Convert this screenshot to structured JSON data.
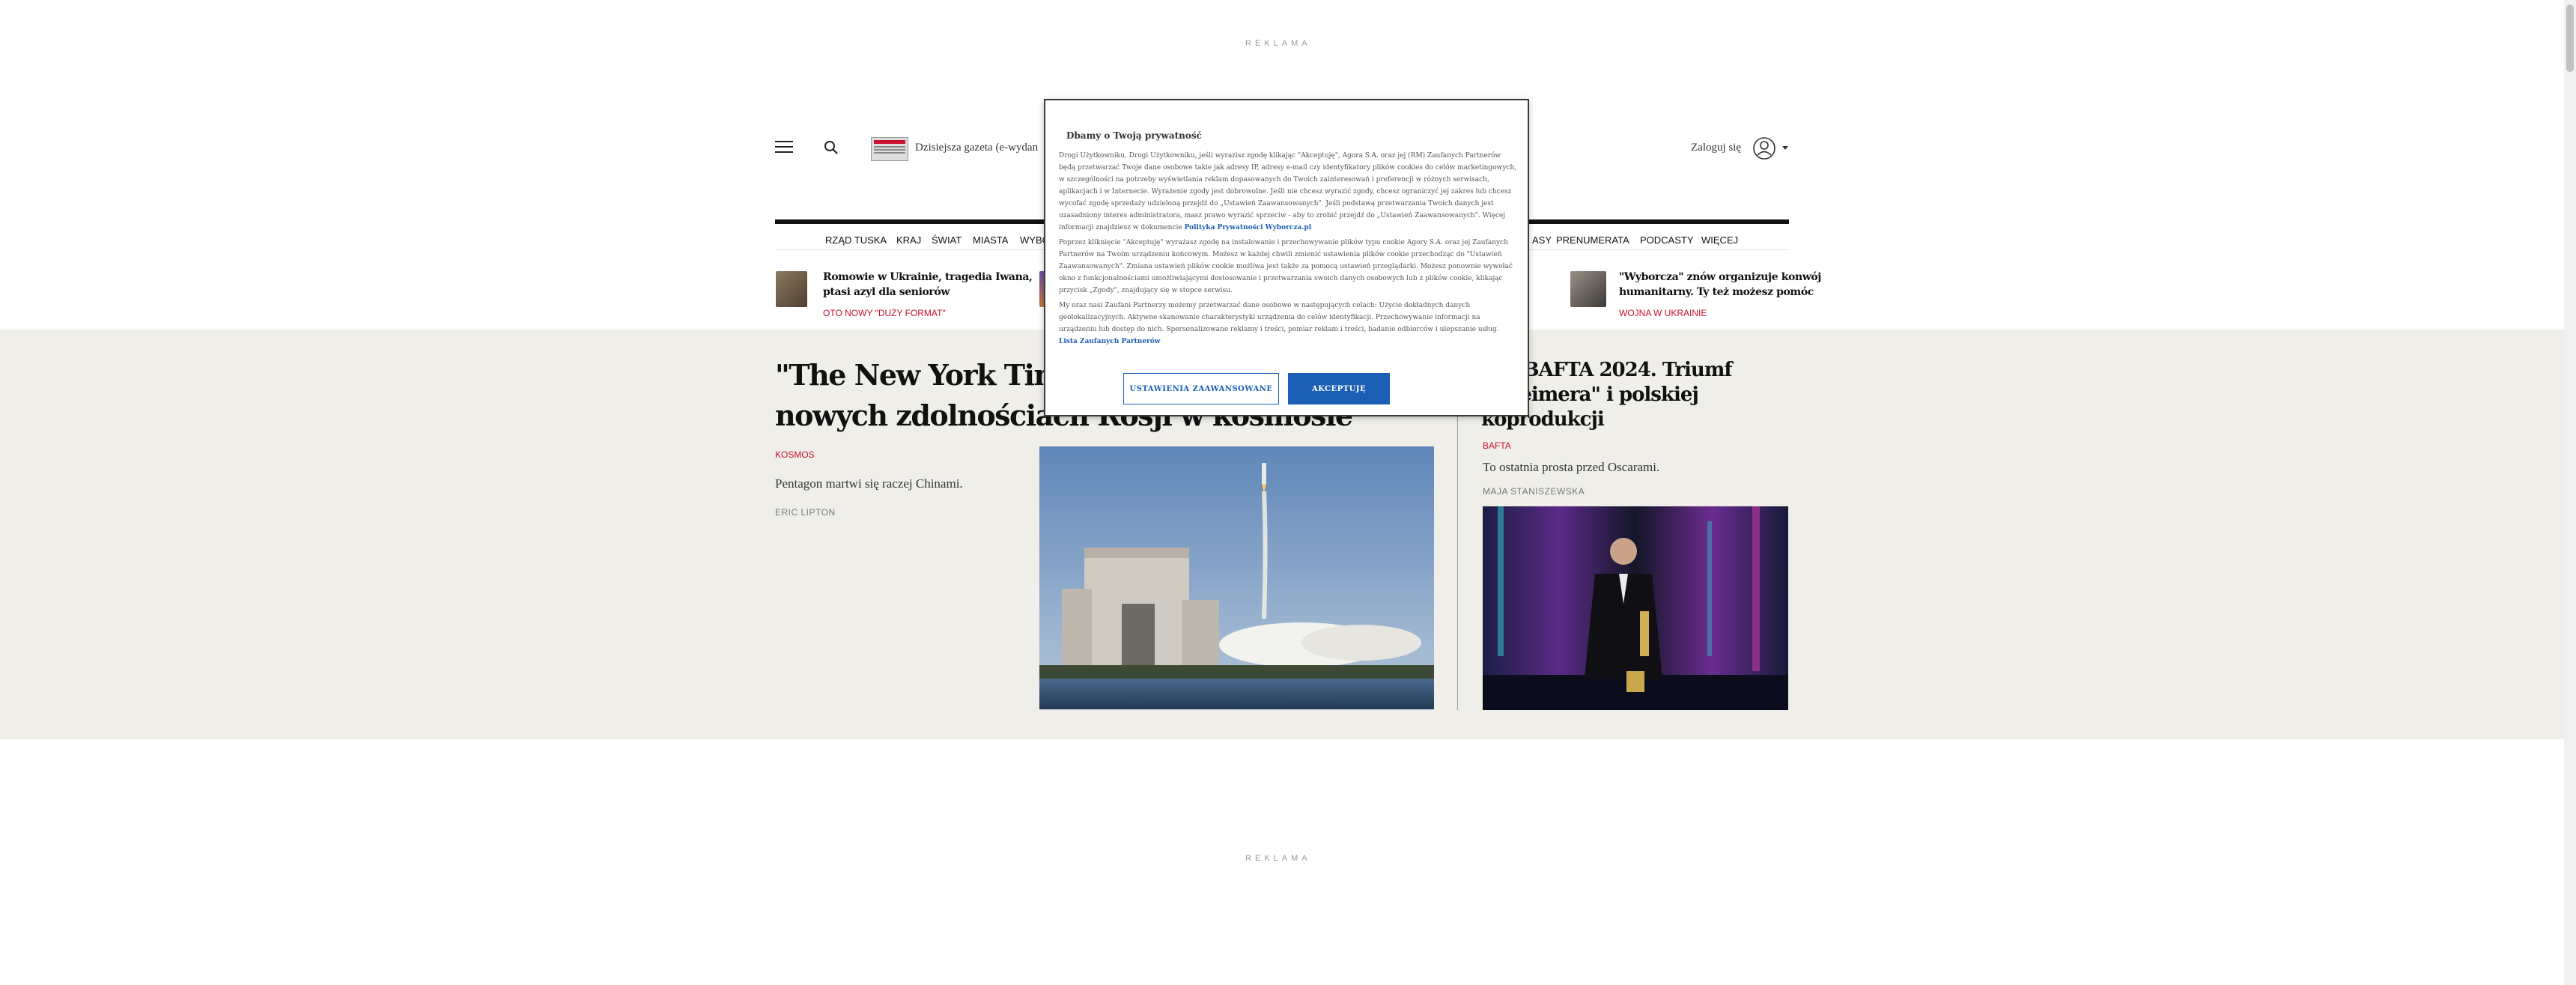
{
  "ads": {
    "top_label": "REKLAMA",
    "bottom_label": "REKLAMA"
  },
  "header": {
    "eprint_label": "Dzisiejsza gazeta (e-wydan",
    "login_label": "Zaloguj się"
  },
  "nav": {
    "items_left": [
      "RZĄD TUSKA",
      "KRAJ",
      "ŚWIAT",
      "MIASTA",
      "WYBO"
    ],
    "items_right": [
      "ASY",
      "PRENUMERATA",
      "PODCASTY",
      "WIĘCEJ"
    ]
  },
  "teasers": [
    {
      "title_line1": "Romowie w Ukrainie, tragedia Iwana,",
      "title_line2": "ptasi azyl dla seniorów",
      "tag": "OTO NOWY \"DUŻY FORMAT\""
    },
    {
      "title_line1": "\"Wyborcza\" znów organizuje konwój",
      "title_line2": "humanitarny. Ty też możesz pomóc",
      "tag": "WOJNA W UKRAINIE"
    }
  ],
  "main_story": {
    "title_line1": "\"The New York Tim",
    "title_line2": "nowych zdolnościach Rosji w kosmosie",
    "category": "KOSMOS",
    "lead": "Pentagon martwi się raczej Chinami.",
    "author": "ERIC LIPTON"
  },
  "side_story": {
    "title_line1": "ody BAFTA 2024. Triumf",
    "title_line2": "enheimera\" i polskiej",
    "title_line3": "koprodukcji",
    "category": "BAFTA",
    "lead": "To ostatnia prosta przed Oscarami.",
    "author": "MAJA STANISZEWSKA"
  },
  "consent": {
    "title": "Dbamy o Twoją prywatność",
    "para1": "Drogi Użytkowniku, Drogi Użytkowniku, jeśli wyrazisz zgodę klikając \"Akceptuję\", Agora S.A. oraz jej (RM) Zaufanych Partnerów będą przetwarzać Twoje dane osobowe takie jak adresy IP, adresy e-mail czy identyfikatory plików cookies do celów marketingowych, w szczególności na potrzeby wyświetlania reklam dopasowanych do Twoich zainteresowań i preferencji w różnych serwisach, aplikacjach i w Internecie. Wyrażenie zgody jest dobrowolne. Jeśli nie chcesz wyrazić zgody, chcesz ograniczyć jej zakres lub chcesz wycofać zgodę sprzedaży udzieloną przejdź do „Ustawień Zaawansowanych\". Jeśli podstawą przetwarzania Twoich danych jest uzasadniony interes administratora, masz prawo wyrazić sprzeciw - aby to zrobić przejdź do „Ustawień Zaawansowanych\". Więcej informacji znajdziesz w dokumencie",
    "policy_link": "Polityka Prywatności Wyborcza.pl",
    "para2": "Poprzez kliknięcie \"Akceptuję\" wyrażasz zgodę na instalowanie i przechowywanie plików typu cookie Agory S.A. oraz jej Zaufanych Partnerów na Twoim urządzeniu końcowym. Możesz w każdej chwili zmienić ustawienia plików cookie przechodząc do \"Ustawień Zaawansowanych\". Zmiana ustawień plików cookie możliwa jest także za pomocą ustawień przeglądarki. Możesz ponownie wywołać okno z funkcjonalnościami umożliwiającymi dostosowanie i przetwarzania swoich danych osobowych lub z plików cookie, klikając przycisk „Zgody\", znajdujący się w stopce serwisu.",
    "para3": "My oraz nasi Zaufani Partnerzy możemy przetwarzać dane osobowe w następujących celach: Użycie dokładnych danych geolokalizacyjnych. Aktywne skanowanie charakterystyki urządzenia do celów identyfikacji. Przechowywanie informacji na urządzeniu lub dostęp do nich. Spersonalizowane reklamy i treści, pomiar reklam i treści, badanie odbiorców i ulepszanie usług.",
    "partners_link": "Lista Zaufanych Partnerów",
    "btn_settings": "USTAWIENIA ZAAWANSOWANE",
    "btn_accept": "AKCEPTUJĘ"
  }
}
